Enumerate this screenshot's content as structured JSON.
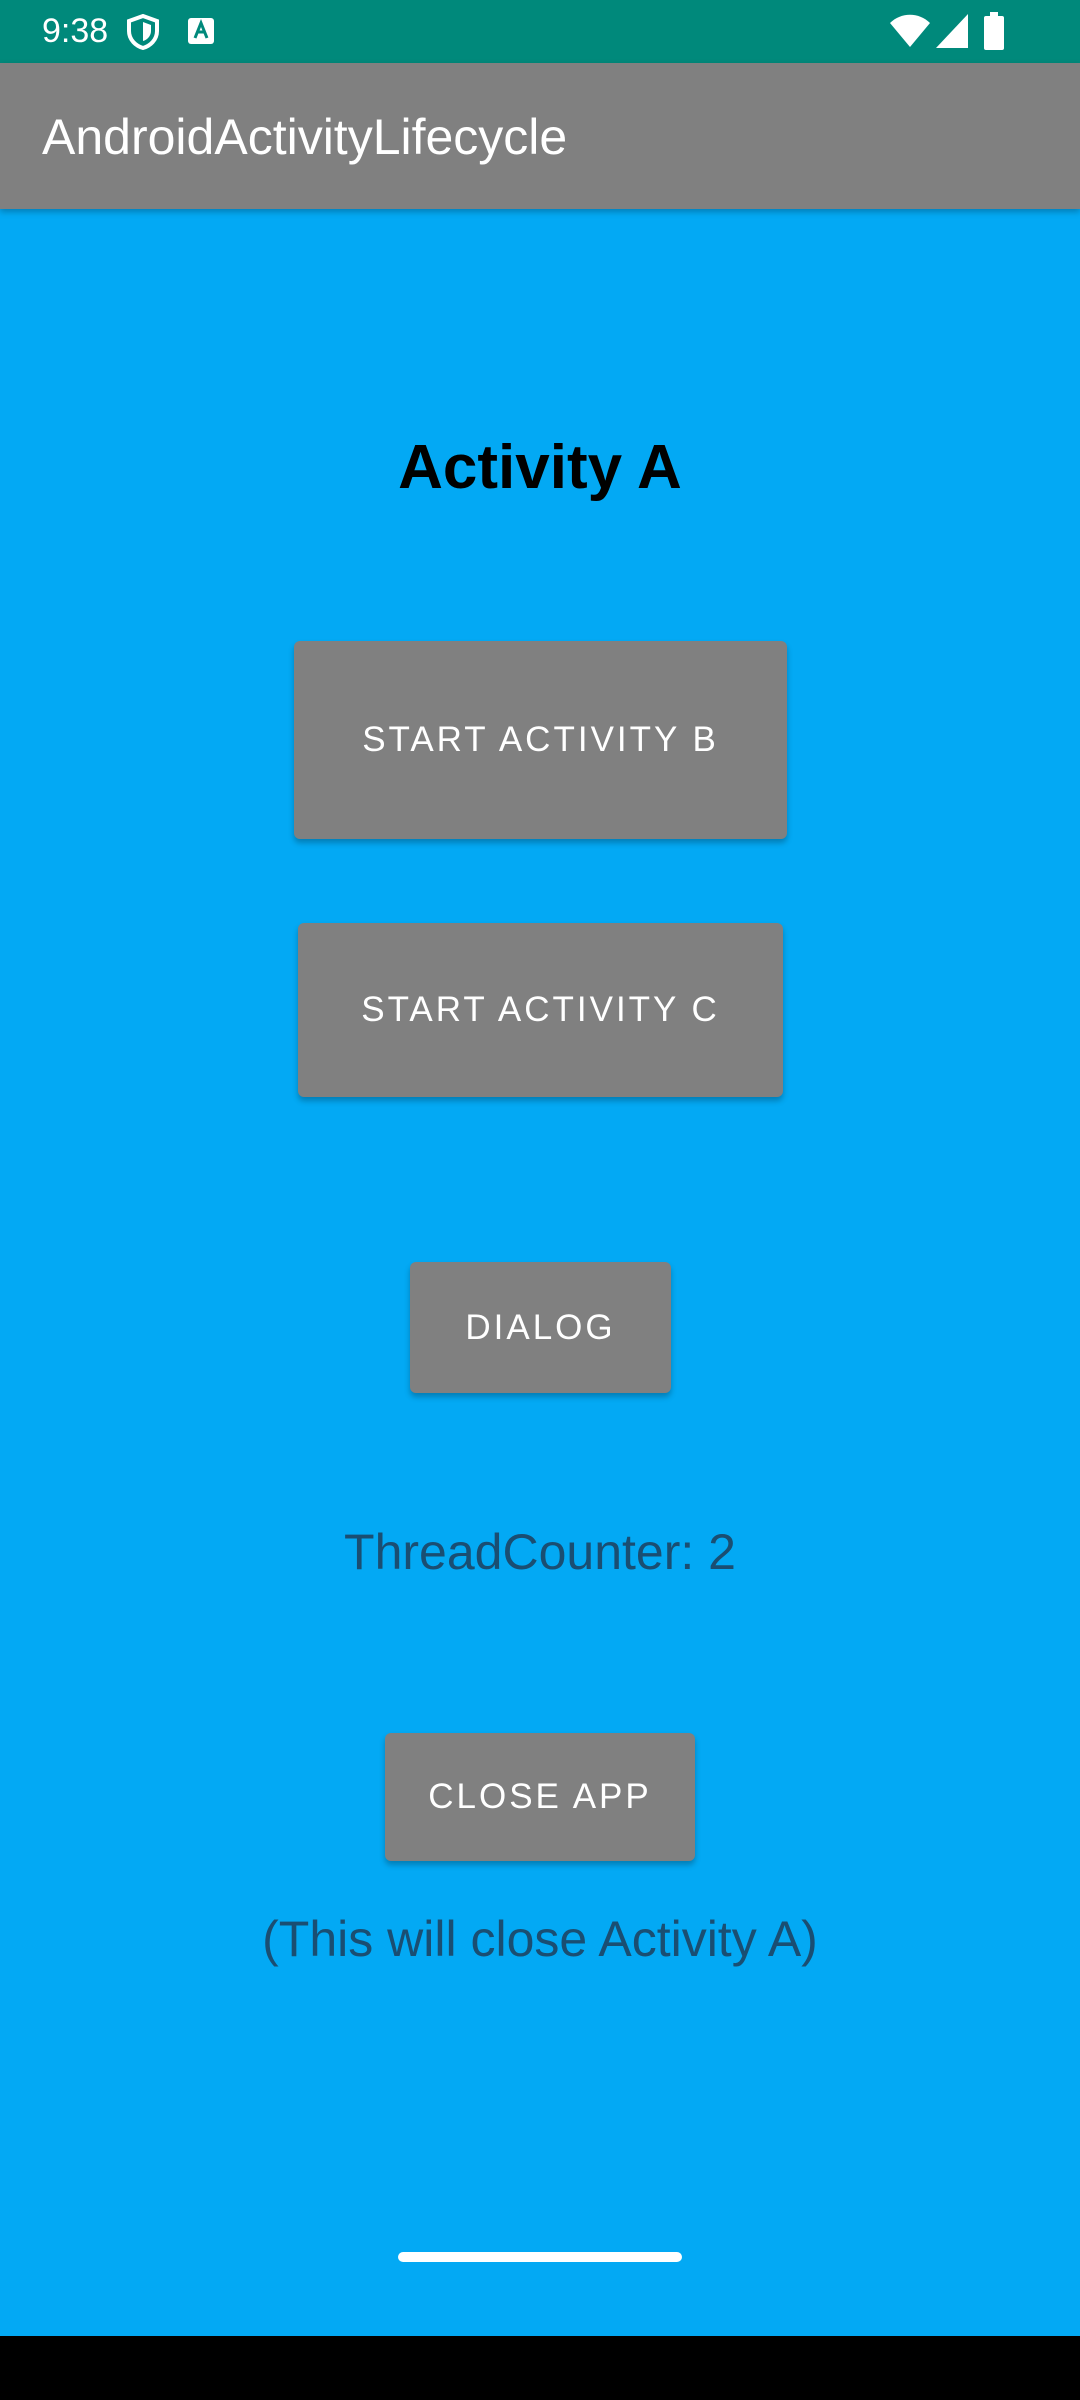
{
  "status_bar": {
    "time": "9:38",
    "left_icons": [
      "shield-icon",
      "text-a-icon"
    ],
    "right_icons": [
      "wifi-icon",
      "signal-icon",
      "battery-icon"
    ],
    "background_color": "#00897B"
  },
  "app_bar": {
    "title": "AndroidActivityLifecycle",
    "background_color": "#808080"
  },
  "main": {
    "background_color": "#03A9F4",
    "heading": "Activity A",
    "buttons": {
      "start_b": "START ACTIVITY B",
      "start_c": "START ACTIVITY C",
      "dialog": "DIALOG",
      "close_app": "CLOSE APP"
    },
    "thread_counter": "ThreadCounter: 2",
    "close_note": "(This will close Activity A)"
  },
  "nav": {
    "handle_icon": "gesture-handle-icon"
  }
}
